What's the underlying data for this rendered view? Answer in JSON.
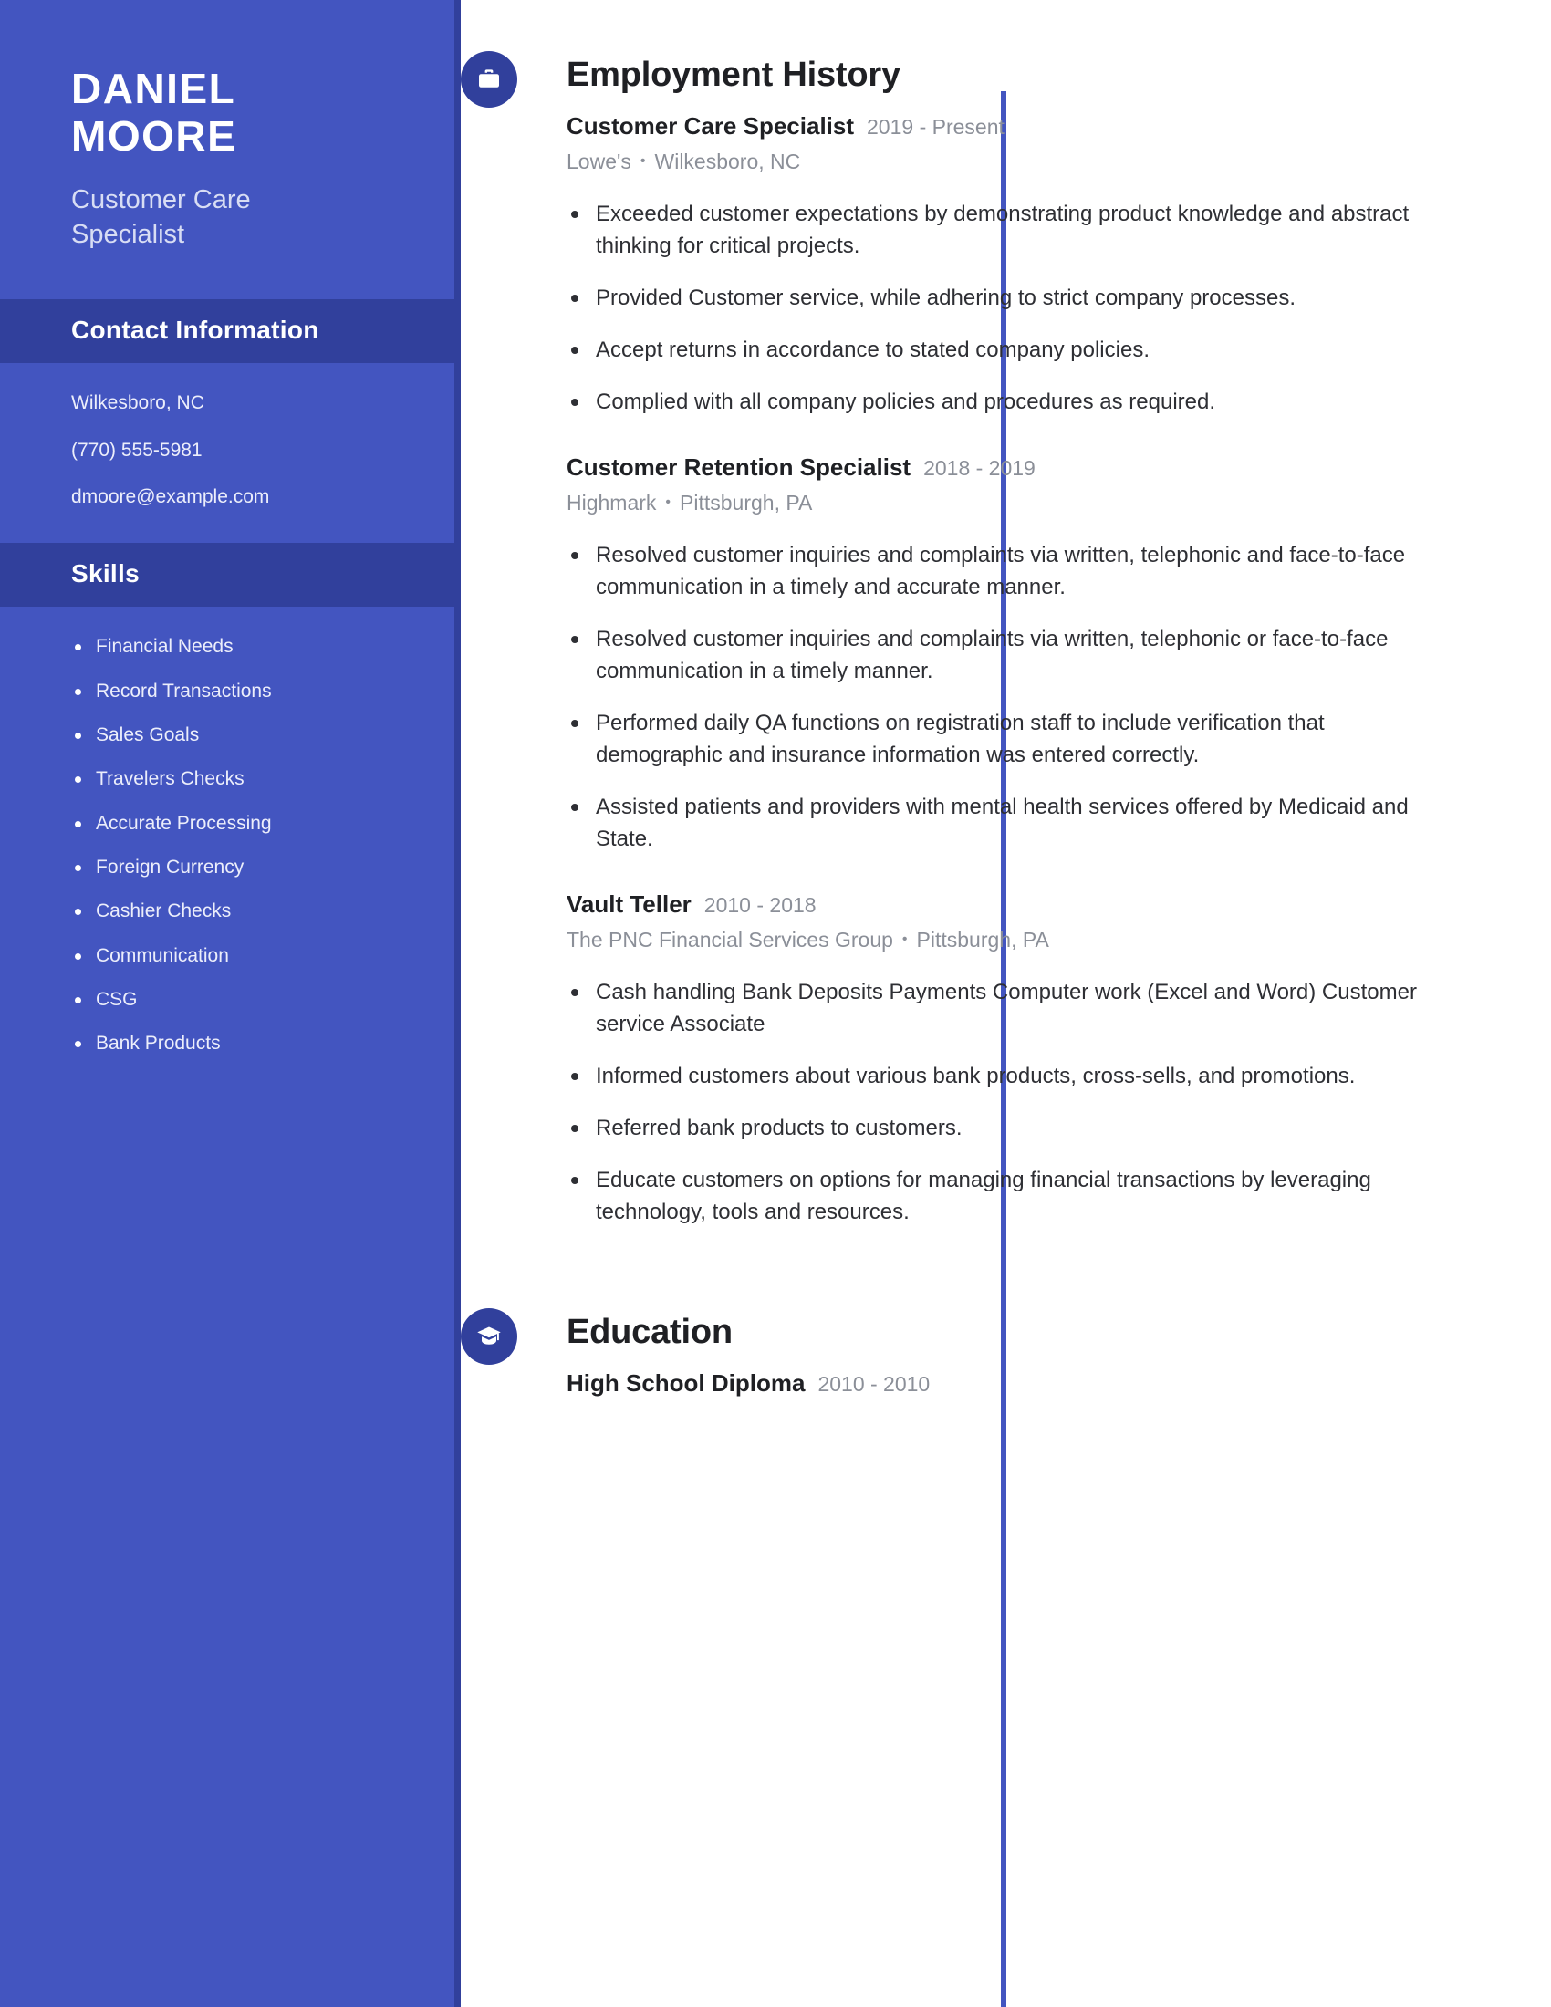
{
  "sidebar": {
    "name_lines": [
      "DANIEL",
      "MOORE"
    ],
    "job_title": "Customer Care Specialist",
    "contact": {
      "heading": "Contact Information",
      "items": [
        "Wilkesboro, NC",
        "(770) 555-5981",
        "dmoore@example.com"
      ]
    },
    "skills": {
      "heading": "Skills",
      "items": [
        "Financial Needs",
        "Record Transactions",
        "Sales Goals",
        "Travelers Checks",
        "Accurate Processing",
        "Foreign Currency",
        "Cashier Checks",
        "Communication",
        "CSG",
        "Bank Products"
      ]
    },
    "colors": {
      "body": "#4355c0",
      "header_bar": "#31409c",
      "text": "#ffffff",
      "subtext": "#d8ddf4"
    }
  },
  "main": {
    "employment": {
      "heading": "Employment History",
      "icon": "briefcase-icon",
      "entries": [
        {
          "title": "Customer Care Specialist",
          "dates": "2019 - Present",
          "company": "Lowe's",
          "location": "Wilkesboro, NC",
          "bullets": [
            "Exceeded customer expectations by demonstrating product knowledge and abstract thinking for critical projects.",
            "Provided Customer service, while adhering to strict company processes.",
            "Accept returns in accordance to stated company policies.",
            "Complied with all company policies and procedures as required."
          ]
        },
        {
          "title": "Customer Retention Specialist",
          "dates": "2018 - 2019",
          "company": "Highmark",
          "location": "Pittsburgh, PA",
          "bullets": [
            "Resolved customer inquiries and complaints via written, telephonic and face-to-face communication in a timely and accurate manner.",
            "Resolved customer inquiries and complaints via written, telephonic or face-to-face communication in a timely manner.",
            "Performed daily QA functions on registration staff to include verification that demographic and insurance information was entered correctly.",
            "Assisted patients and providers with mental health services offered by Medicaid and State."
          ]
        },
        {
          "title": "Vault Teller",
          "dates": "2010 - 2018",
          "company": "The PNC Financial Services Group",
          "location": "Pittsburgh, PA",
          "bullets": [
            "Cash handling Bank Deposits Payments Computer work (Excel and Word) Customer service Associate",
            "Informed customers about various bank products, cross-sells, and promotions.",
            "Referred bank products to customers.",
            "Educate customers on options for managing financial transactions by leveraging technology, tools and resources."
          ]
        }
      ]
    },
    "education": {
      "heading": "Education",
      "icon": "graduation-cap-icon",
      "entries": [
        {
          "title": "High School Diploma",
          "dates": "2010 - 2010"
        }
      ]
    },
    "separator": "•"
  }
}
